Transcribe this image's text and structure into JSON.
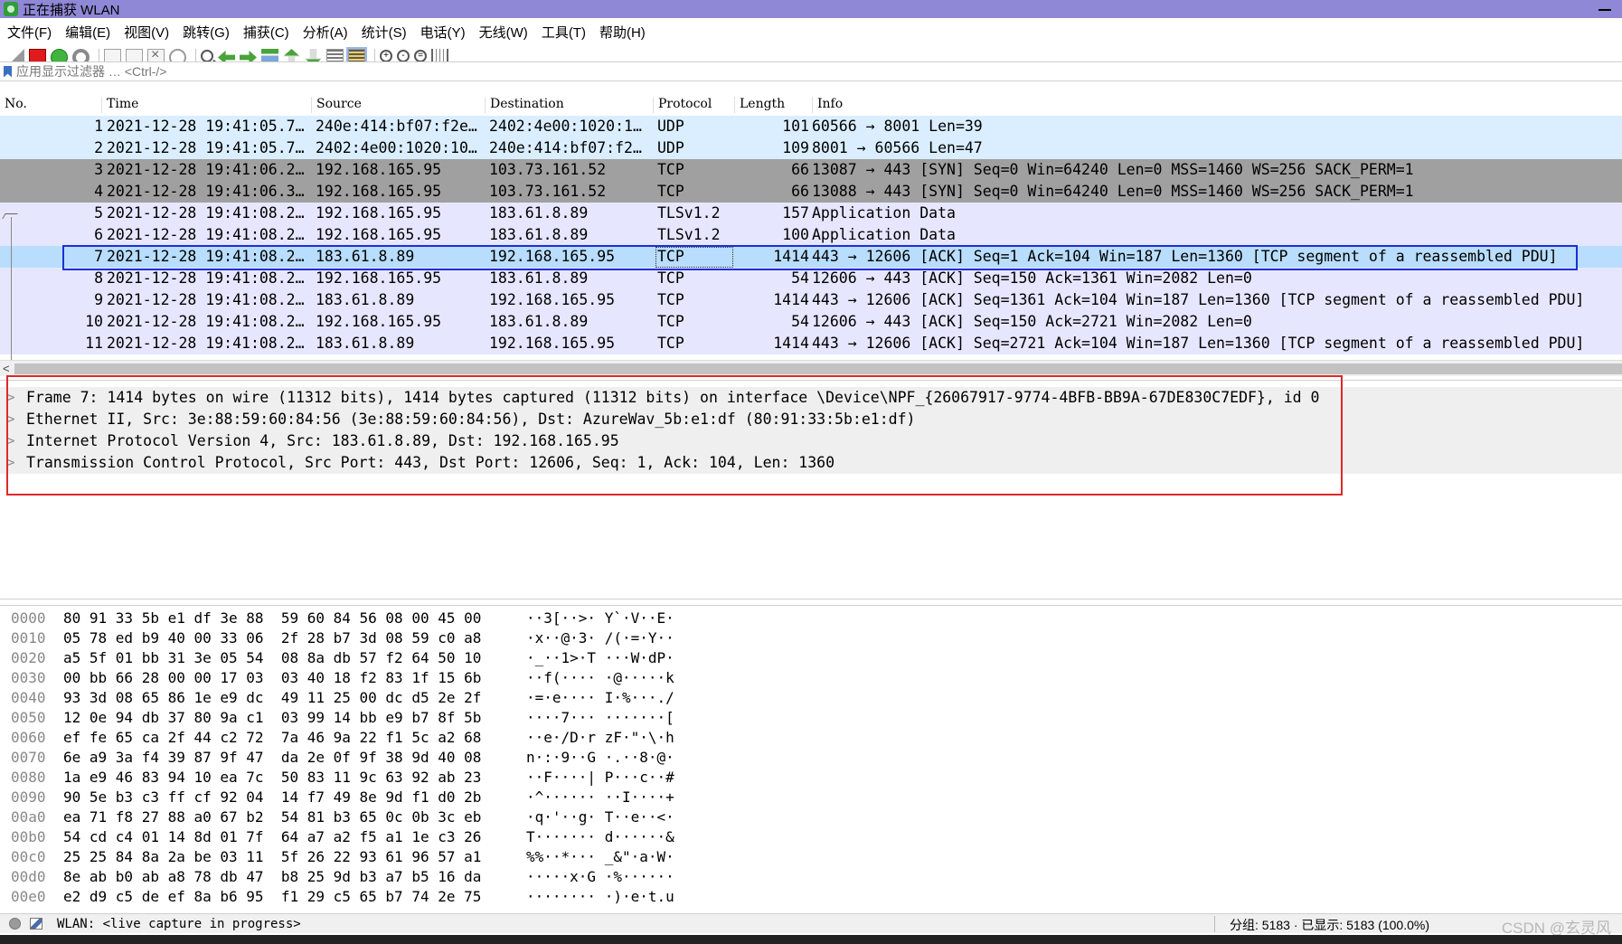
{
  "window": {
    "title": "正在捕获 WLAN"
  },
  "menu": [
    "文件(F)",
    "编辑(E)",
    "视图(V)",
    "跳转(G)",
    "捕获(C)",
    "分析(A)",
    "统计(S)",
    "电话(Y)",
    "无线(W)",
    "工具(T)",
    "帮助(H)"
  ],
  "filter": {
    "placeholder": "应用显示过滤器 … <Ctrl-/>"
  },
  "columns": {
    "no": "No.",
    "time": "Time",
    "source": "Source",
    "destination": "Destination",
    "protocol": "Protocol",
    "length": "Length",
    "info": "Info"
  },
  "packets": [
    {
      "no": "1",
      "time": "2021-12-28 19:41:05.7…",
      "src": "240e:414:bf07:f2e…",
      "dst": "2402:4e00:1020:1…",
      "proto": "UDP",
      "len": "101",
      "info": "60566 → 8001 Len=39"
    },
    {
      "no": "2",
      "time": "2021-12-28 19:41:05.7…",
      "src": "2402:4e00:1020:10…",
      "dst": "240e:414:bf07:f2…",
      "proto": "UDP",
      "len": "109",
      "info": "8001 → 60566 Len=47"
    },
    {
      "no": "3",
      "time": "2021-12-28 19:41:06.2…",
      "src": "192.168.165.95",
      "dst": "103.73.161.52",
      "proto": "TCP",
      "len": "66",
      "info": "13087 → 443 [SYN] Seq=0 Win=64240 Len=0 MSS=1460 WS=256 SACK_PERM=1"
    },
    {
      "no": "4",
      "time": "2021-12-28 19:41:06.3…",
      "src": "192.168.165.95",
      "dst": "103.73.161.52",
      "proto": "TCP",
      "len": "66",
      "info": "13088 → 443 [SYN] Seq=0 Win=64240 Len=0 MSS=1460 WS=256 SACK_PERM=1"
    },
    {
      "no": "5",
      "time": "2021-12-28 19:41:08.2…",
      "src": "192.168.165.95",
      "dst": "183.61.8.89",
      "proto": "TLSv1.2",
      "len": "157",
      "info": "Application Data"
    },
    {
      "no": "6",
      "time": "2021-12-28 19:41:08.2…",
      "src": "192.168.165.95",
      "dst": "183.61.8.89",
      "proto": "TLSv1.2",
      "len": "100",
      "info": "Application Data"
    },
    {
      "no": "7",
      "time": "2021-12-28 19:41:08.2…",
      "src": "183.61.8.89",
      "dst": "192.168.165.95",
      "proto": "TCP",
      "len": "1414",
      "info": "443 → 12606 [ACK] Seq=1 Ack=104 Win=187 Len=1360 [TCP segment of a reassembled PDU]"
    },
    {
      "no": "8",
      "time": "2021-12-28 19:41:08.2…",
      "src": "192.168.165.95",
      "dst": "183.61.8.89",
      "proto": "TCP",
      "len": "54",
      "info": "12606 → 443 [ACK] Seq=150 Ack=1361 Win=2082 Len=0"
    },
    {
      "no": "9",
      "time": "2021-12-28 19:41:08.2…",
      "src": "183.61.8.89",
      "dst": "192.168.165.95",
      "proto": "TCP",
      "len": "1414",
      "info": "443 → 12606 [ACK] Seq=1361 Ack=104 Win=187 Len=1360 [TCP segment of a reassembled PDU]"
    },
    {
      "no": "10",
      "time": "2021-12-28 19:41:08.2…",
      "src": "192.168.165.95",
      "dst": "183.61.8.89",
      "proto": "TCP",
      "len": "54",
      "info": "12606 → 443 [ACK] Seq=150 Ack=2721 Win=2082 Len=0"
    },
    {
      "no": "11",
      "time": "2021-12-28 19:41:08.2…",
      "src": "183.61.8.89",
      "dst": "192.168.165.95",
      "proto": "TCP",
      "len": "1414",
      "info": "443 → 12606 [ACK] Seq=2721 Ack=104 Win=187 Len=1360 [TCP segment of a reassembled PDU]"
    }
  ],
  "details": [
    "Frame 7: 1414 bytes on wire (11312 bits), 1414 bytes captured (11312 bits) on interface \\Device\\NPF_{26067917-9774-4BFB-BB9A-67DE830C7EDF}, id 0",
    "Ethernet II, Src: 3e:88:59:60:84:56 (3e:88:59:60:84:56), Dst: AzureWav_5b:e1:df (80:91:33:5b:e1:df)",
    "Internet Protocol Version 4, Src: 183.61.8.89, Dst: 192.168.165.95",
    "Transmission Control Protocol, Src Port: 443, Dst Port: 12606, Seq: 1, Ack: 104, Len: 1360"
  ],
  "bytes": [
    {
      "off": "0000",
      "hex": "80 91 33 5b e1 df 3e 88  59 60 84 56 08 00 45 00",
      "asc": "··3[··>· Y`·V··E·"
    },
    {
      "off": "0010",
      "hex": "05 78 ed b9 40 00 33 06  2f 28 b7 3d 08 59 c0 a8",
      "asc": "·x··@·3· /(·=·Y··"
    },
    {
      "off": "0020",
      "hex": "a5 5f 01 bb 31 3e 05 54  08 8a db 57 f2 64 50 10",
      "asc": "·_··1>·T ···W·dP·"
    },
    {
      "off": "0030",
      "hex": "00 bb 66 28 00 00 17 03  03 40 18 f2 83 1f 15 6b",
      "asc": "··f(···· ·@·····k"
    },
    {
      "off": "0040",
      "hex": "93 3d 08 65 86 1e e9 dc  49 11 25 00 dc d5 2e 2f",
      "asc": "·=·e···· I·%···./"
    },
    {
      "off": "0050",
      "hex": "12 0e 94 db 37 80 9a c1  03 99 14 bb e9 b7 8f 5b",
      "asc": "····7··· ·······["
    },
    {
      "off": "0060",
      "hex": "ef fe 65 ca 2f 44 c2 72  7a 46 9a 22 f1 5c a2 68",
      "asc": "··e·/D·r zF·\"·\\·h"
    },
    {
      "off": "0070",
      "hex": "6e a9 3a f4 39 87 9f 47  da 2e 0f 9f 38 9d 40 08",
      "asc": "n·:·9··G ·.··8·@·"
    },
    {
      "off": "0080",
      "hex": "1a e9 46 83 94 10 ea 7c  50 83 11 9c 63 92 ab 23",
      "asc": "··F····| P···c··#"
    },
    {
      "off": "0090",
      "hex": "90 5e b3 c3 ff cf 92 04  14 f7 49 8e 9d f1 d0 2b",
      "asc": "·^······ ··I····+"
    },
    {
      "off": "00a0",
      "hex": "ea 71 f8 27 88 a0 67 b2  54 81 b3 65 0c 0b 3c eb",
      "asc": "·q·'··g· T··e··<·"
    },
    {
      "off": "00b0",
      "hex": "54 cd c4 01 14 8d 01 7f  64 a7 a2 f5 a1 1e c3 26",
      "asc": "T······· d······&"
    },
    {
      "off": "00c0",
      "hex": "25 25 84 8a 2a be 03 11  5f 26 22 93 61 96 57 a1",
      "asc": "%%··*··· _&\"·a·W·"
    },
    {
      "off": "00d0",
      "hex": "8e ab b0 ab a8 78 db 47  b8 25 9d b3 a7 b5 16 da",
      "asc": "·····x·G ·%······"
    },
    {
      "off": "00e0",
      "hex": "e2 d9 c5 de ef 8a b6 95  f1 29 c5 65 b7 74 2e 75",
      "asc": "········ ·)·e·t.u"
    }
  ],
  "status": {
    "capture": "WLAN: <live capture in progress>",
    "counts": "分组: 5183 · 已显示: 5183 (100.0%)",
    "watermark": "CSDN @玄灵风"
  }
}
